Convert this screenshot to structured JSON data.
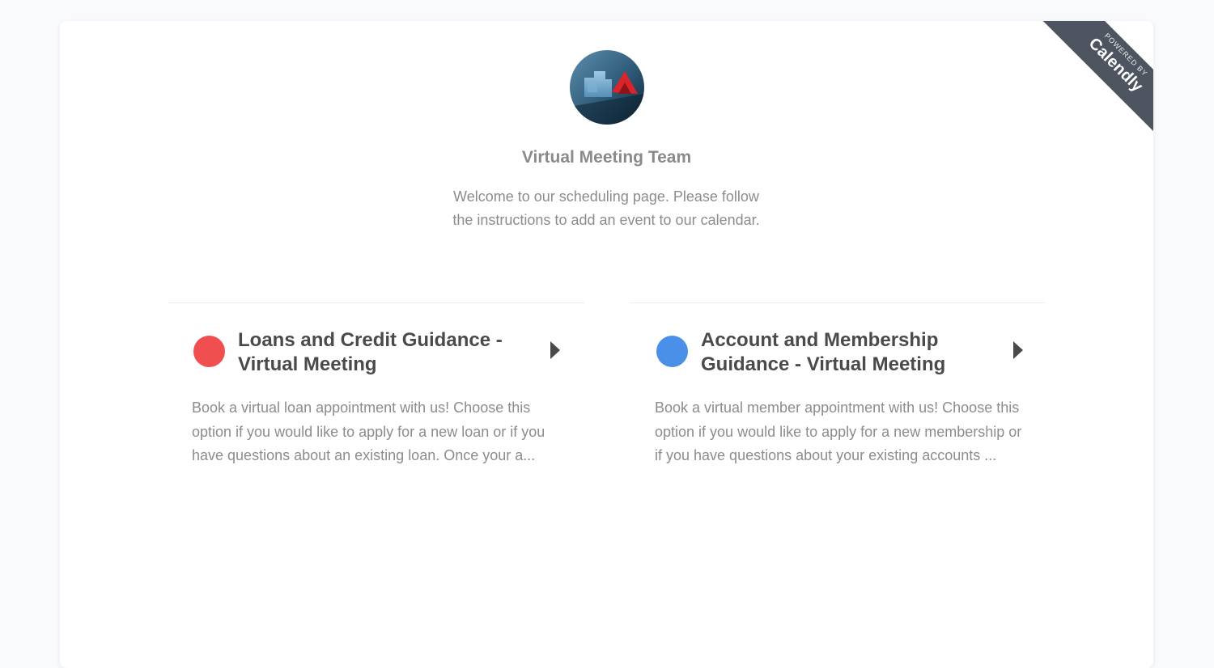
{
  "branding": {
    "powered_by": "POWERED BY",
    "brand_name": "Calendly"
  },
  "profile": {
    "avatar_icon": "team-logo-image",
    "name": "Virtual Meeting Team",
    "welcome_message": "Welcome to our scheduling page. Please follow the instructions to add an event to our calendar."
  },
  "events": [
    {
      "title": "Loans and Credit Guidance - Virtual Meeting",
      "description": "Book a virtual loan appointment with us! Choose this option if you would like to apply for a new loan or if you have questions about an existing loan. Once your a...",
      "color": "#ef4f4f",
      "arrow_icon": "caret-right-icon"
    },
    {
      "title": "Account and Membership Guidance - Virtual Meeting",
      "description": "Book a virtual member appointment with us! Choose this option if you would like to apply for a new membership or if you have questions about your existing accounts ...",
      "color": "#4a90e8",
      "arrow_icon": "caret-right-icon"
    }
  ]
}
